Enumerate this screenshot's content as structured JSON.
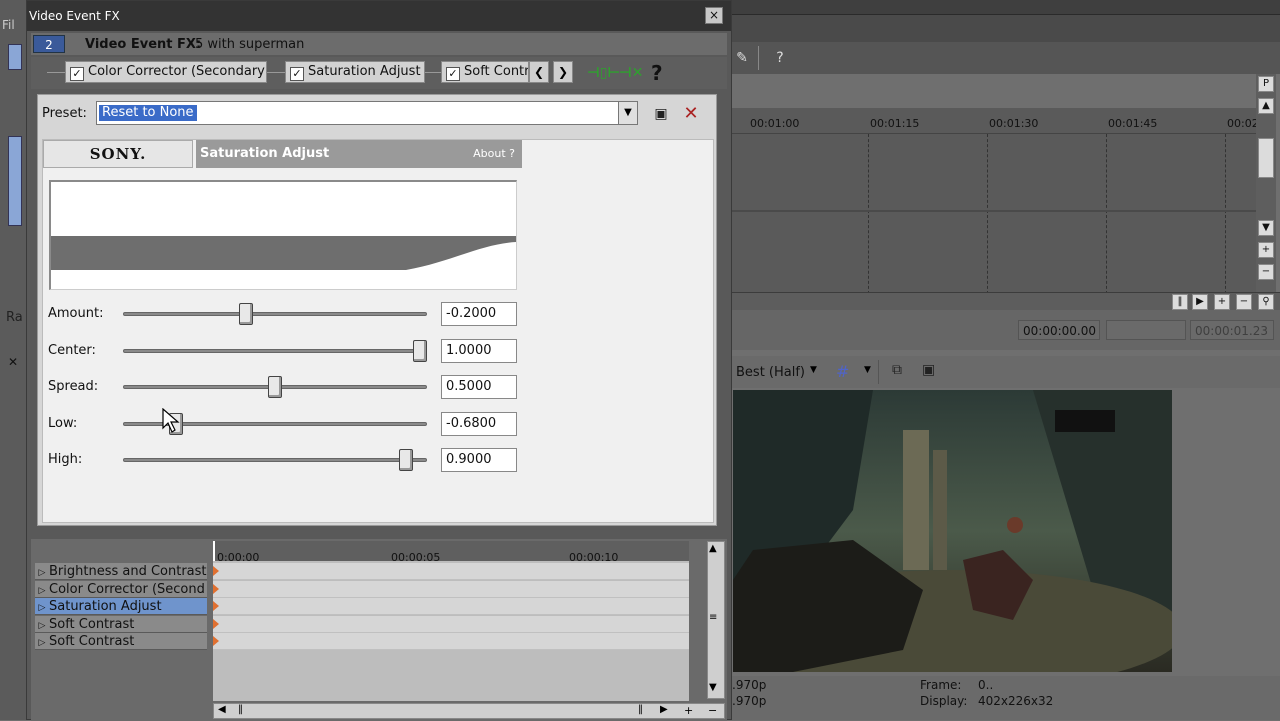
{
  "window": {
    "title": "Video Event FX",
    "close": "×",
    "event_number": "2",
    "header_label": "Video Event FX:",
    "header_value": "5 with superman"
  },
  "fx_chain": [
    {
      "label": "Color Corrector (Secondary)",
      "checked": true
    },
    {
      "label": "Saturation Adjust",
      "checked": true
    },
    {
      "label": "Soft Contr",
      "checked": true
    }
  ],
  "chain_nav": {
    "prev": "❮",
    "next": "❯",
    "help": "?"
  },
  "preset": {
    "label": "Preset:",
    "value": "Reset to None"
  },
  "plugin": {
    "brand": "SONY.",
    "name": "Saturation Adjust",
    "about": "About  ?"
  },
  "sliders": [
    {
      "label": "Amount:",
      "value": "-0.2000",
      "fraction": 0.4
    },
    {
      "label": "Center:",
      "value": "1.0000",
      "fraction": 1.0
    },
    {
      "label": "Spread:",
      "value": "0.5000",
      "fraction": 0.5
    },
    {
      "label": "Low:",
      "value": "-0.6800",
      "fraction": 0.16
    },
    {
      "label": "High:",
      "value": "0.9000",
      "fraction": 0.95
    }
  ],
  "fx_timeline": {
    "ticks": [
      "0:00:00",
      "00:00:05",
      "00:00:10"
    ],
    "items": [
      {
        "label": "Brightness and Contrast",
        "selected": false
      },
      {
        "label": "Color Corrector (Second",
        "selected": false
      },
      {
        "label": "Saturation Adjust",
        "selected": true
      },
      {
        "label": "Soft Contrast",
        "selected": false
      },
      {
        "label": "Soft Contrast",
        "selected": false
      }
    ]
  },
  "host": {
    "ruler": [
      "00:01:00",
      "00:01:15",
      "00:01:30",
      "00:01:45",
      "00:02"
    ],
    "timecode_cursor": "00:00:00.00",
    "timecode_end": "00:00:01.23",
    "preview_quality": "Best (Half)",
    "info": {
      "left1": ".970p",
      "left2": ".970p",
      "frame_label": "Frame:",
      "frame_value": "0..",
      "display_label": "Display:",
      "display_value": "402x226x32"
    },
    "left_edge_text1": "Fil",
    "left_edge_text2": "Ra"
  },
  "colors": {
    "accent": "#3a6bc8",
    "selected_row": "#6f94cc",
    "keyframe": "#e07030"
  }
}
